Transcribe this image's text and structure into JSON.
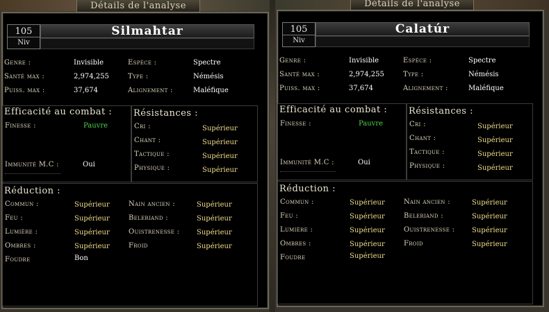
{
  "panels": [
    {
      "window_title": "Détails de l'analyse",
      "level": "105",
      "level_label": "Niv",
      "name": "Silmahtar",
      "info": {
        "genre_label": "Genre :",
        "genre": "Invisible",
        "espece_label": "Espèce :",
        "espece": "Spectre",
        "sante_label": "Santé max :",
        "sante": "2,974,255",
        "type_label": "Type :",
        "type": "Némésis",
        "puiss_label": "Puiss. max :",
        "puiss": "37,674",
        "align_label": "Alignement :",
        "align": "Maléfique"
      },
      "combat": {
        "title": "Efficacité au combat :",
        "finesse_label": "Finesse :",
        "finesse": "Pauvre",
        "immunite_label": "Immunité M.C :",
        "immunite": "Oui"
      },
      "resist": {
        "title": "Résistances :",
        "items": [
          {
            "label": "Cri :",
            "value": "Supérieur"
          },
          {
            "label": "Chant :",
            "value": "Supérieur"
          },
          {
            "label": "Tactique :",
            "value": "Supérieur"
          },
          {
            "label": "Physique :",
            "value": "Supérieur"
          }
        ]
      },
      "reduction": {
        "title": "Réduction :",
        "left": [
          {
            "label": "Commun :",
            "value": "Supérieur"
          },
          {
            "label": "Feu :",
            "value": "Supérieur"
          },
          {
            "label": "Lumière :",
            "value": "Supérieur"
          },
          {
            "label": "Ombres :",
            "value": "Supérieur"
          },
          {
            "label": "Foudre",
            "value": "Bon"
          }
        ],
        "right": [
          {
            "label": "Nain ancien :",
            "value": "Supérieur"
          },
          {
            "label": "Beleriand :",
            "value": "Supérieur"
          },
          {
            "label": "Ouistrenesse :",
            "value": "Supérieur"
          },
          {
            "label": "Froid",
            "value": "Supérieur"
          }
        ]
      }
    },
    {
      "window_title": "Détails de l'analyse",
      "level": "105",
      "level_label": "Niv",
      "name": "Calatúr",
      "info": {
        "genre_label": "Genre :",
        "genre": "Invisible",
        "espece_label": "Espèce :",
        "espece": "Spectre",
        "sante_label": "Santé max :",
        "sante": "2,974,255",
        "type_label": "Type :",
        "type": "Némésis",
        "puiss_label": "Puiss. max :",
        "puiss": "37,674",
        "align_label": "Alignement :",
        "align": "Maléfique"
      },
      "combat": {
        "title": "Efficacité au combat :",
        "finesse_label": "Finesse :",
        "finesse": "Pauvre",
        "immunite_label": "Immunité M.C :",
        "immunite": "Oui"
      },
      "resist": {
        "title": "Résistances :",
        "items": [
          {
            "label": "Cri :",
            "value": "Supérieur"
          },
          {
            "label": "Chant :",
            "value": "Supérieur"
          },
          {
            "label": "Tactique :",
            "value": "Supérieur"
          },
          {
            "label": "Physique :",
            "value": "Supérieur"
          }
        ]
      },
      "reduction": {
        "title": "Réduction :",
        "left": [
          {
            "label": "Commun :",
            "value": "Supérieur"
          },
          {
            "label": "Feu :",
            "value": "Supérieur"
          },
          {
            "label": "Lumière :",
            "value": "Supérieur"
          },
          {
            "label": "Ombres :",
            "value": "Supérieur"
          },
          {
            "label": "Foudre",
            "value": "Supérieur"
          }
        ],
        "right": [
          {
            "label": "Nain ancien :",
            "value": "Supérieur"
          },
          {
            "label": "Beleriand :",
            "value": "Supérieur"
          },
          {
            "label": "Ouistrenesse :",
            "value": "Supérieur"
          },
          {
            "label": "Froid",
            "value": "Supérieur"
          }
        ]
      }
    }
  ],
  "colors": {
    "value_good": "#f0dd8c",
    "value_poor": "#4dd24d",
    "frame_border": "#6a6656"
  }
}
